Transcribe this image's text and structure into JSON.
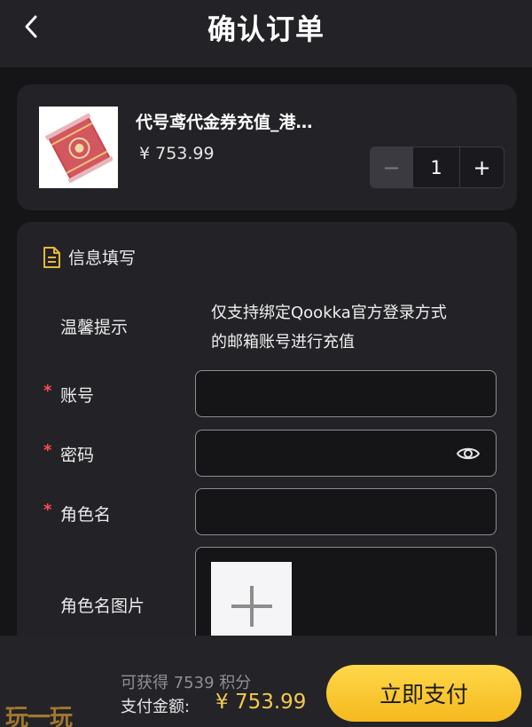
{
  "header": {
    "title": "确认订单",
    "back_icon": "chevron-left-icon"
  },
  "product": {
    "title": "代号鸢代金券充值_港…",
    "price": "¥ 753.99",
    "quantity": "1",
    "minus_label": "−",
    "plus_label": "+"
  },
  "form": {
    "section_title": "信息填写",
    "required_mark": "*",
    "notice_label": "温馨提示",
    "notice_text_line1": "仅支持绑定Qookka官方登录方式",
    "notice_text_line2": "的邮箱账号进行充值",
    "account_label": "账号",
    "password_label": "密码",
    "role_name_label": "角色名",
    "role_image_label": "角色名图片",
    "account_value": "",
    "password_value": "",
    "role_name_value": ""
  },
  "footer": {
    "points": "可获得 7539 积分",
    "pay_label": "支付金额:",
    "pay_amount": "¥ 753.99",
    "pay_button": "立即支付",
    "watermark": "玩一玩"
  },
  "colors": {
    "accent": "#f5c232",
    "required": "#ff4d4f",
    "background": "#151518",
    "card": "#222227"
  }
}
